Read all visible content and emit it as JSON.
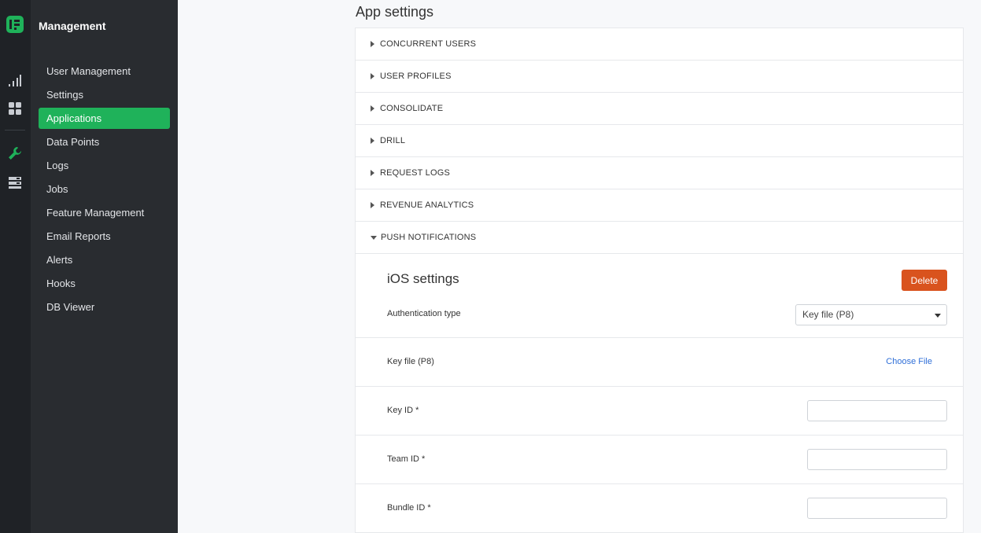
{
  "sidebar": {
    "title": "Management",
    "items": [
      {
        "label": "User Management"
      },
      {
        "label": "Settings"
      },
      {
        "label": "Applications"
      },
      {
        "label": "Data Points"
      },
      {
        "label": "Logs"
      },
      {
        "label": "Jobs"
      },
      {
        "label": "Feature Management"
      },
      {
        "label": "Email Reports"
      },
      {
        "label": "Alerts"
      },
      {
        "label": "Hooks"
      },
      {
        "label": "DB Viewer"
      }
    ],
    "active_index": 2,
    "accent_color": "#1fb25a"
  },
  "rail": {
    "icons": [
      "logo-icon",
      "analytics-icon",
      "dashboard-grid-icon",
      "wrench-icon",
      "database-icon"
    ]
  },
  "main": {
    "title": "App settings",
    "sections": [
      {
        "label": "CONCURRENT USERS",
        "expanded": false
      },
      {
        "label": "USER PROFILES",
        "expanded": false
      },
      {
        "label": "CONSOLIDATE",
        "expanded": false
      },
      {
        "label": "DRILL",
        "expanded": false
      },
      {
        "label": "REQUEST LOGS",
        "expanded": false
      },
      {
        "label": "REVENUE ANALYTICS",
        "expanded": false
      },
      {
        "label": "PUSH NOTIFICATIONS",
        "expanded": true
      }
    ],
    "ios": {
      "title": "iOS settings",
      "delete_label": "Delete",
      "delete_color": "#d9531e",
      "auth_type_label": "Authentication type",
      "auth_type_value": "Key file (P8)",
      "key_file_label": "Key file (P8)",
      "choose_file_label": "Choose File",
      "key_id_label": "Key ID *",
      "key_id_value": "",
      "team_id_label": "Team ID *",
      "team_id_value": "",
      "bundle_id_label": "Bundle ID *",
      "bundle_id_value": ""
    }
  }
}
